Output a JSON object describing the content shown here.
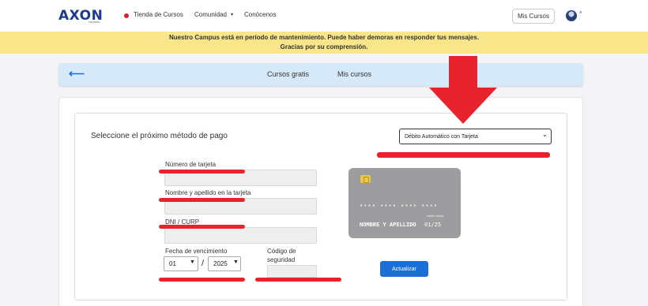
{
  "nav": {
    "logo": "AXON",
    "logo_sub": "TRAINING",
    "links": [
      "Tienda de Cursos",
      "Comunidad",
      "Conócenos"
    ],
    "my_courses_button": "Mis Cursos",
    "accent": "#1e3a8a"
  },
  "banner": {
    "line1": "Nuestro Campus está en período de mantenimiento. Puede haber demoras en responder tus mensajes.",
    "line2": "Gracias por su comprensión.",
    "color": "#f9e68a"
  },
  "tabs": [
    "Cursos gratis",
    "Mis cursos"
  ],
  "payment": {
    "title": "Seleccione el próximo método de pago",
    "method_selected": "Débito Automático con Tarjeta",
    "fields": {
      "card_number_label": "Número de tarjeta",
      "name_label": "Nombre y apellido en la tarjeta",
      "dni_label": "DNI / CURP",
      "expiry_label": "Fecha de vencimiento",
      "security_label_1": "Código de",
      "security_label_2": "seguridad",
      "month": "01",
      "year": "2025",
      "slash": "/"
    },
    "card_preview": {
      "number": "•••• •••• •••• ••••",
      "valid_label": "valido hasta",
      "name": "NOMBRE Y APELLIDO",
      "expiry": "01/25"
    },
    "submit_button": "Actualizar",
    "submit_color": "#1d6fd8"
  },
  "annotation_color": "#e8232e"
}
